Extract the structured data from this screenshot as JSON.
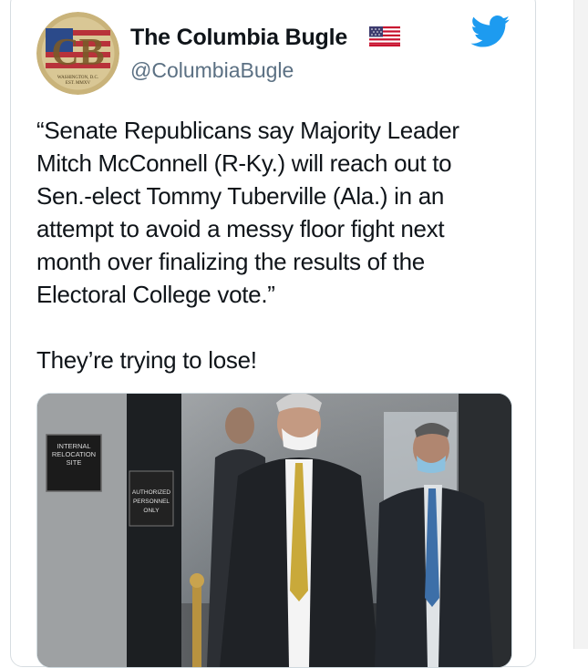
{
  "account": {
    "display_name": "The Columbia Bugle",
    "handle": "@ColumbiaBugle",
    "avatar_monogram": "CB",
    "avatar_caption_line1": "WASHINGTON, D.C.",
    "avatar_caption_line2": "EST. MMXV",
    "flag_icon": "us-flag-icon",
    "platform_icon": "twitter-bird-icon"
  },
  "tweet": {
    "quote": "“Senate Republicans say Majority Leader\nMitch McConnell (R-Ky.) will reach out to\nSen.-elect Tommy Tuberville (Ala.) in an\nattempt to avoid a messy floor fight next\nmonth over finalizing the results of the\nElectoral College vote.”",
    "comment": "They’re trying to lose!"
  },
  "media": {
    "sign_left": [
      "INTERNAL",
      "RELOCATION",
      "SITE"
    ],
    "sign_door": [
      "AUTHORIZED",
      "PERSONNEL",
      "ONLY"
    ]
  },
  "colors": {
    "twitter_blue": "#1d9bf0",
    "text_primary": "#0f1419",
    "text_secondary": "#5b7083"
  }
}
